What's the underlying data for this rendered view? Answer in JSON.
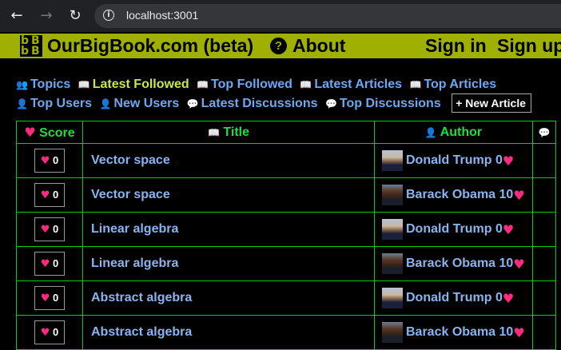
{
  "browser": {
    "url": "localhost:3001"
  },
  "site": {
    "logo_letters": [
      "b",
      "B",
      "b",
      "B"
    ],
    "brand": "OurBigBook.com (beta)",
    "about_icon": "?",
    "about": "About",
    "sign_in": "Sign in",
    "sign_up": "Sign up"
  },
  "tabs": [
    {
      "label": "Topics",
      "icon": "users-icon",
      "glyph": "👥",
      "active": false
    },
    {
      "label": "Latest Followed",
      "icon": "book-icon",
      "glyph": "📖",
      "active": true
    },
    {
      "label": "Top Followed",
      "icon": "book-icon",
      "glyph": "📖",
      "active": false
    },
    {
      "label": "Latest Articles",
      "icon": "book-icon",
      "glyph": "📖",
      "active": false
    },
    {
      "label": "Top Articles",
      "icon": "book-icon",
      "glyph": "📖",
      "active": false
    },
    {
      "label": "Top Users",
      "icon": "user-icon",
      "glyph": "👤",
      "active": false
    },
    {
      "label": "New Users",
      "icon": "user-icon",
      "glyph": "👤",
      "active": false
    },
    {
      "label": "Latest Discussions",
      "icon": "comment-icon",
      "glyph": "💬",
      "active": false
    },
    {
      "label": "Top Discussions",
      "icon": "comment-icon",
      "glyph": "💬",
      "active": false
    }
  ],
  "new_article": {
    "plus": "+",
    "label": "New Article"
  },
  "table": {
    "headers": {
      "score": "Score",
      "title": "Title",
      "author": "Author"
    },
    "rows": [
      {
        "score": "0",
        "title": "Vector space",
        "author": "Donald Trump",
        "author_score": "0",
        "avatar": "trump"
      },
      {
        "score": "0",
        "title": "Vector space",
        "author": "Barack Obama",
        "author_score": "10",
        "avatar": "obama"
      },
      {
        "score": "0",
        "title": "Linear algebra",
        "author": "Donald Trump",
        "author_score": "0",
        "avatar": "trump"
      },
      {
        "score": "0",
        "title": "Linear algebra",
        "author": "Barack Obama",
        "author_score": "10",
        "avatar": "obama"
      },
      {
        "score": "0",
        "title": "Abstract algebra",
        "author": "Donald Trump",
        "author_score": "0",
        "avatar": "trump"
      },
      {
        "score": "0",
        "title": "Abstract algebra",
        "author": "Barack Obama",
        "author_score": "10",
        "avatar": "obama"
      }
    ]
  },
  "colors": {
    "header_bg": "#a0b000",
    "link": "#88b4f0",
    "active_tab": "#c8e84a",
    "heart": "#ff2a80",
    "table_border": "#00d000"
  }
}
